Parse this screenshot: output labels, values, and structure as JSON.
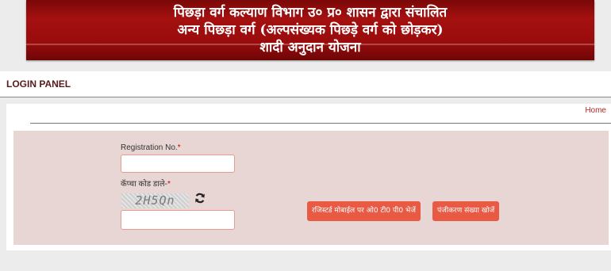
{
  "banner": {
    "line1": "पिछड़ा  वर्ग कल्याण विभाग उ० प्र० शासन द्वारा संचालित",
    "line2": "अन्य पिछड़ा वर्ग (अल्पसंख्यक पिछड़े वर्ग को छोड़कर)",
    "line3": "शादी अनुदान योजना"
  },
  "login_panel": {
    "title": "LOGIN PANEL"
  },
  "nav": {
    "home": "Home"
  },
  "form": {
    "registration_label": "Registration No.",
    "registration_value": "",
    "captcha_label": "कॅप्चा कोड डाले-",
    "captcha_text": "2H5Qn",
    "captcha_value": "",
    "required_mark": "*"
  },
  "buttons": {
    "send_otp": "रजिस्टर्ड मोबाईल पर ओ0 टी0 पी0 भेजें",
    "find_registration": "पंजीकरण संख्या खोजें"
  },
  "icons": {
    "refresh": "refresh-icon"
  }
}
